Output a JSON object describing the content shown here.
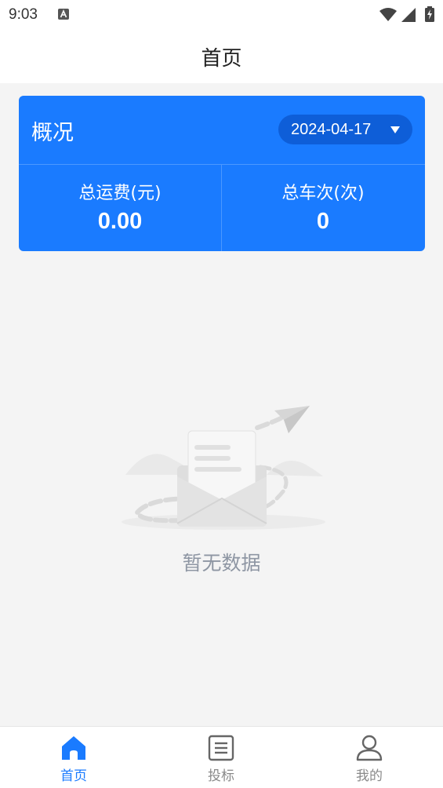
{
  "status_bar": {
    "time": "9:03",
    "icons": [
      "a-icon",
      "wifi-icon",
      "signal-icon",
      "battery-icon"
    ]
  },
  "header": {
    "title": "首页"
  },
  "overview": {
    "title": "概况",
    "date": "2024-04-17",
    "stats": [
      {
        "label": "总运费(元)",
        "value": "0.00"
      },
      {
        "label": "总车次(次)",
        "value": "0"
      }
    ]
  },
  "empty_state": {
    "text": "暂无数据"
  },
  "bottom_nav": {
    "items": [
      {
        "label": "首页",
        "icon": "home-icon",
        "active": true
      },
      {
        "label": "投标",
        "icon": "document-icon",
        "active": false
      },
      {
        "label": "我的",
        "icon": "user-icon",
        "active": false
      }
    ]
  },
  "colors": {
    "accent": "#1a7bff",
    "date_pill": "#0e5ed8",
    "background": "#f4f4f4",
    "inactive_nav": "#8a8a8a",
    "empty_text": "#8e96a3"
  }
}
